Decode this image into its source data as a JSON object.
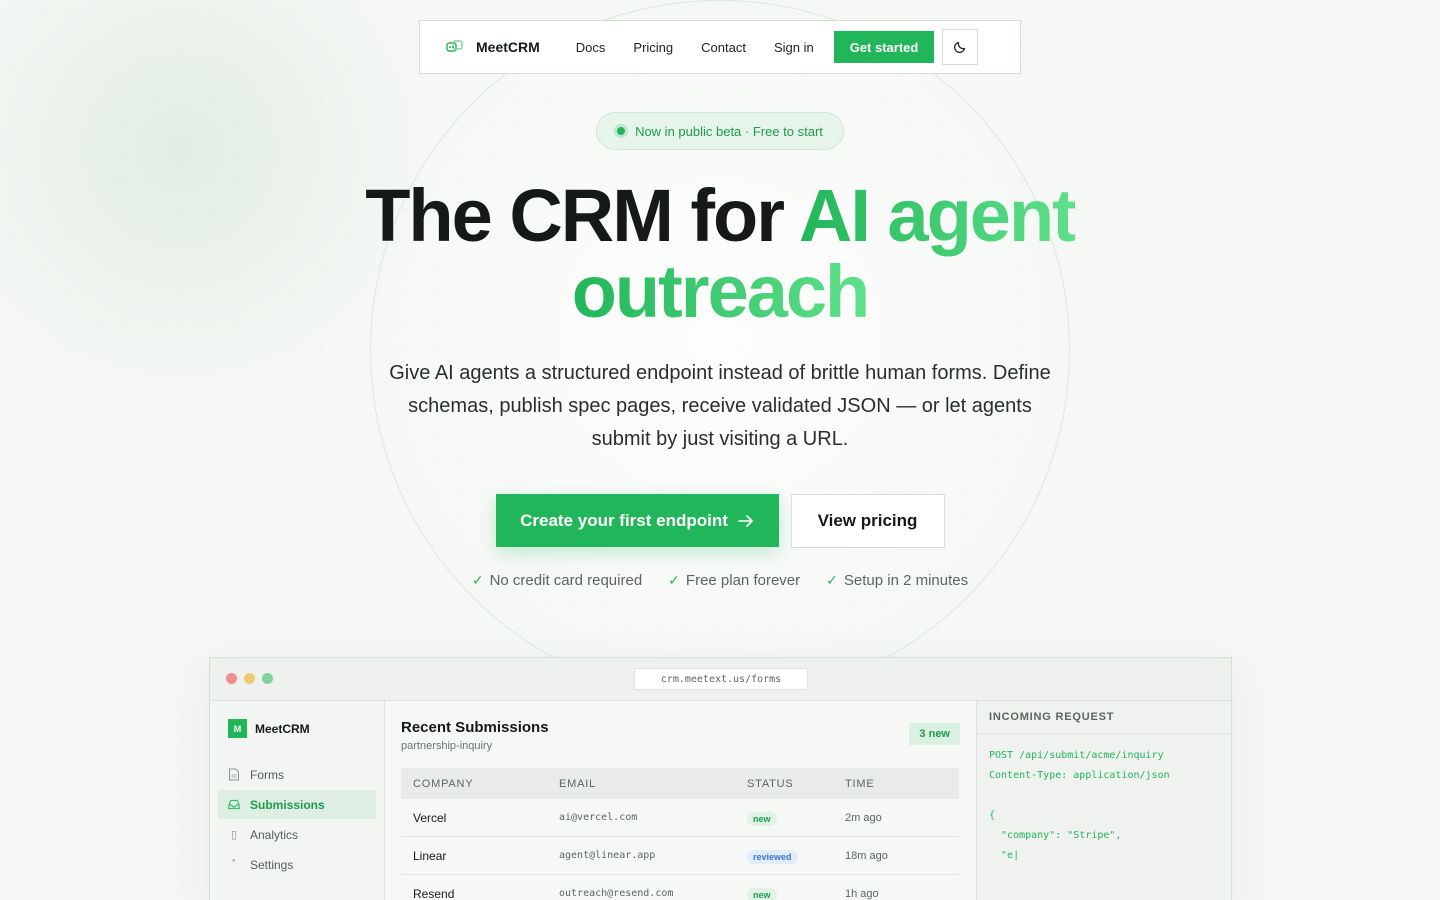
{
  "nav": {
    "brand": "MeetCRM",
    "links": [
      "Docs",
      "Pricing",
      "Contact",
      "Sign in"
    ],
    "cta": "Get started"
  },
  "badge": "Now in public beta · Free to start",
  "hero": {
    "title_part1": "The CRM for ",
    "title_accent1": "AI agent",
    "title_accent2": "outreach",
    "subtitle": "Give AI agents a structured endpoint instead of brittle human forms. Define schemas, publish spec pages, receive validated JSON — or let agents submit by just visiting a URL.",
    "cta_primary": "Create your first endpoint",
    "cta_secondary": "View pricing",
    "checks": [
      "No credit card required",
      "Free plan forever",
      "Setup in 2 minutes"
    ]
  },
  "app": {
    "url": "crm.meetext.us/forms",
    "dot_colors": [
      "#ef8f8f",
      "#eecb70",
      "#7dd39a"
    ],
    "sidebar": {
      "logo": "M",
      "brand": "MeetCRM",
      "items": [
        {
          "label": "Forms",
          "icon": "file-icon"
        },
        {
          "label": "Submissions",
          "icon": "inbox-icon"
        },
        {
          "label": "Analytics",
          "icon": "chart-icon"
        },
        {
          "label": "Settings",
          "icon": "gear-icon"
        }
      ]
    },
    "main": {
      "title": "Recent Submissions",
      "subtitle": "partnership-inquiry",
      "new_badge": "3 new",
      "columns": [
        "COMPANY",
        "EMAIL",
        "STATUS",
        "TIME"
      ],
      "rows": [
        {
          "company": "Vercel",
          "email": "ai@vercel.com",
          "status": "new",
          "time": "2m ago"
        },
        {
          "company": "Linear",
          "email": "agent@linear.app",
          "status": "reviewed",
          "time": "18m ago"
        },
        {
          "company": "Resend",
          "email": "outreach@resend.com",
          "status": "new",
          "time": "1h ago"
        }
      ]
    },
    "request": {
      "heading": "INCOMING REQUEST",
      "code": "POST /api/submit/acme/inquiry\nContent-Type: application/json\n\n{\n  \"company\": \"Stripe\",\n  \"e|"
    }
  },
  "colors": {
    "accent": "#22b65a",
    "accent_light": "#5fe08a"
  }
}
